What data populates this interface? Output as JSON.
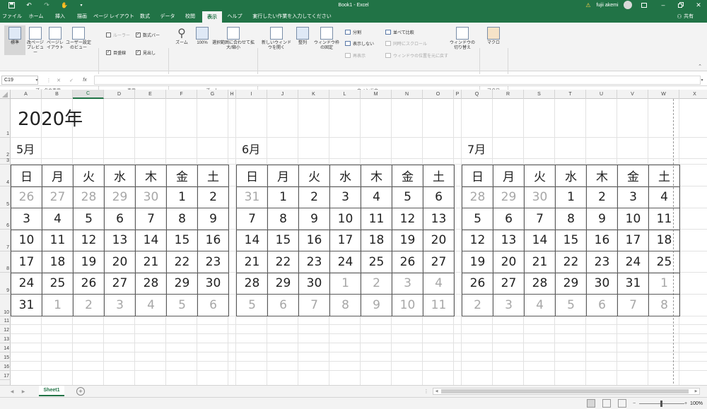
{
  "titlebar": {
    "doc_title": "Book1 - Excel",
    "search_hint": "実行したい作業を入力してください",
    "user": "fujii akemi",
    "share": "共有"
  },
  "tabs": [
    "ファイル",
    "ホーム",
    "挿入",
    "描画",
    "ページ レイアウト",
    "数式",
    "データ",
    "校閲",
    "表示",
    "ヘルプ"
  ],
  "active_tab": "表示",
  "colors": {
    "excel_green": "#217346",
    "gray_date": "#a7a7a7"
  },
  "ribbon": {
    "views": {
      "normal": "標準",
      "page_break": "改ページプレビュー",
      "page_layout": "ページレイアウト",
      "custom_views": "ユーザー設定のビュー",
      "group": "ブックの表示"
    },
    "show": {
      "ruler": "ルーラー",
      "formula_bar": "数式バー",
      "gridlines": "目盛線",
      "headings": "見出し",
      "group": "表示"
    },
    "zoom": {
      "zoom": "ズーム",
      "pct100": "100%",
      "zoom_selection": "選択範囲に合わせて拡大/縮小",
      "group": "ズーム"
    },
    "window": {
      "new_window": "新しいウィンドウを開く",
      "arrange": "整列",
      "freeze": "ウィンドウ枠の固定",
      "split": "分割",
      "hide": "表示しない",
      "unhide": "再表示",
      "side_by_side": "並べて比較",
      "sync_scroll": "同時にスクロール",
      "reset_pos": "ウィンドウの位置を元に戻す",
      "switch": "ウィンドウの切り替え",
      "group": "ウィンドウ"
    },
    "macro": {
      "macros": "マクロ",
      "group": "マクロ"
    }
  },
  "formula_bar": {
    "cell_ref": "C19",
    "fx": "fx",
    "value": ""
  },
  "columns": [
    "A",
    "B",
    "C",
    "D",
    "E",
    "F",
    "G",
    "H",
    "I",
    "J",
    "K",
    "L",
    "M",
    "N",
    "O",
    "P",
    "Q",
    "R",
    "S",
    "T",
    "U",
    "V",
    "W",
    "X"
  ],
  "selected_column": "C",
  "rows": [
    "1",
    "2",
    "3",
    "4",
    "5",
    "6",
    "7",
    "8",
    "9",
    "10",
    "11",
    "12",
    "13",
    "14",
    "15",
    "16",
    "17"
  ],
  "sheet": {
    "year_title": "2020年"
  },
  "weekdays": [
    "日",
    "月",
    "火",
    "水",
    "木",
    "金",
    "土"
  ],
  "months": [
    {
      "label": "5月",
      "weeks": [
        [
          26,
          27,
          28,
          29,
          30,
          1,
          2
        ],
        [
          3,
          4,
          5,
          6,
          7,
          8,
          9
        ],
        [
          10,
          11,
          12,
          13,
          14,
          15,
          16
        ],
        [
          17,
          18,
          19,
          20,
          21,
          22,
          23
        ],
        [
          24,
          25,
          26,
          27,
          28,
          29,
          30
        ],
        [
          31,
          1,
          2,
          3,
          4,
          5,
          6
        ]
      ],
      "other": [
        [
          1,
          1,
          1,
          1,
          1,
          0,
          0
        ],
        [
          0,
          0,
          0,
          0,
          0,
          0,
          0
        ],
        [
          0,
          0,
          0,
          0,
          0,
          0,
          0
        ],
        [
          0,
          0,
          0,
          0,
          0,
          0,
          0
        ],
        [
          0,
          0,
          0,
          0,
          0,
          0,
          0
        ],
        [
          0,
          1,
          1,
          1,
          1,
          1,
          1
        ]
      ]
    },
    {
      "label": "6月",
      "weeks": [
        [
          31,
          1,
          2,
          3,
          4,
          5,
          6
        ],
        [
          7,
          8,
          9,
          10,
          11,
          12,
          13
        ],
        [
          14,
          15,
          16,
          17,
          18,
          19,
          20
        ],
        [
          21,
          22,
          23,
          24,
          25,
          26,
          27
        ],
        [
          28,
          29,
          30,
          1,
          2,
          3,
          4
        ],
        [
          5,
          6,
          7,
          8,
          9,
          10,
          11
        ]
      ],
      "other": [
        [
          1,
          0,
          0,
          0,
          0,
          0,
          0
        ],
        [
          0,
          0,
          0,
          0,
          0,
          0,
          0
        ],
        [
          0,
          0,
          0,
          0,
          0,
          0,
          0
        ],
        [
          0,
          0,
          0,
          0,
          0,
          0,
          0
        ],
        [
          0,
          0,
          0,
          1,
          1,
          1,
          1
        ],
        [
          1,
          1,
          1,
          1,
          1,
          1,
          1
        ]
      ]
    },
    {
      "label": "7月",
      "weeks": [
        [
          28,
          29,
          30,
          1,
          2,
          3,
          4
        ],
        [
          5,
          6,
          7,
          8,
          9,
          10,
          11
        ],
        [
          12,
          13,
          14,
          15,
          16,
          17,
          18
        ],
        [
          19,
          20,
          21,
          22,
          23,
          24,
          25
        ],
        [
          26,
          27,
          28,
          29,
          30,
          31,
          1
        ],
        [
          2,
          3,
          4,
          5,
          6,
          7,
          8
        ]
      ],
      "other": [
        [
          1,
          1,
          1,
          0,
          0,
          0,
          0
        ],
        [
          0,
          0,
          0,
          0,
          0,
          0,
          0
        ],
        [
          0,
          0,
          0,
          0,
          0,
          0,
          0
        ],
        [
          0,
          0,
          0,
          0,
          0,
          0,
          0
        ],
        [
          0,
          0,
          0,
          0,
          0,
          0,
          1
        ],
        [
          1,
          1,
          1,
          1,
          1,
          1,
          1
        ]
      ]
    }
  ],
  "sheet_tabs": {
    "active": "Sheet1",
    "add": "+"
  },
  "status": {
    "zoom_level": "100%"
  }
}
